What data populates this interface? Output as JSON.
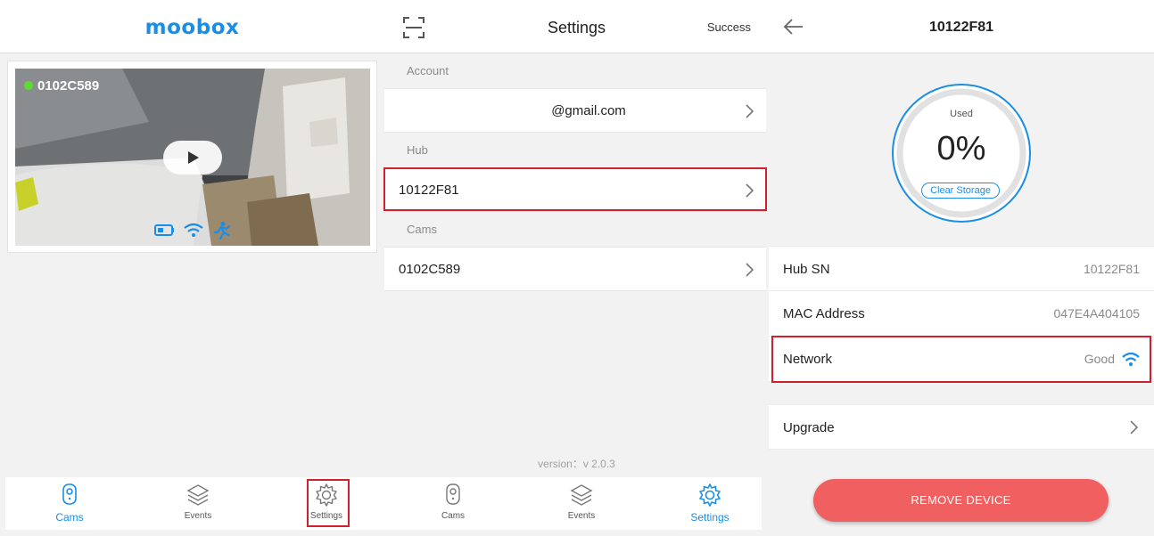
{
  "colors": {
    "accent": "#1a8ee6",
    "highlight": "#d21f2e",
    "danger": "#f06060",
    "online": "#5ddb2e"
  },
  "screen1": {
    "logo": "moobox",
    "camera": {
      "name": "0102C589",
      "status": "online"
    },
    "nav": [
      {
        "label": "Cams",
        "icon": "camera-icon",
        "active": true
      },
      {
        "label": "Events",
        "icon": "layers-icon",
        "active": false
      },
      {
        "label": "Settings",
        "icon": "gear-icon",
        "active": false
      }
    ]
  },
  "screen2": {
    "title": "Settings",
    "status": "Success",
    "sections": {
      "account": {
        "label": "Account",
        "value": "@gmail.com"
      },
      "hub": {
        "label": "Hub",
        "value": "10122F81"
      },
      "cams": {
        "label": "Cams",
        "value": "0102C589"
      }
    },
    "version": "version：v 2.0.3",
    "nav": [
      {
        "label": "Cams",
        "icon": "camera-icon",
        "active": false
      },
      {
        "label": "Events",
        "icon": "layers-icon",
        "active": false
      },
      {
        "label": "Settings",
        "icon": "gear-icon",
        "active": true
      }
    ]
  },
  "screen3": {
    "title": "10122F81",
    "storage": {
      "used_label": "Used",
      "used_percent": "0%",
      "clear_label": "Clear Storage"
    },
    "info": [
      {
        "label": "Hub SN",
        "value": "10122F81"
      },
      {
        "label": "MAC Address",
        "value": "047E4A404105"
      },
      {
        "label": "Network",
        "value": "Good"
      }
    ],
    "upgrade_label": "Upgrade",
    "remove_label": "REMOVE DEVICE"
  }
}
